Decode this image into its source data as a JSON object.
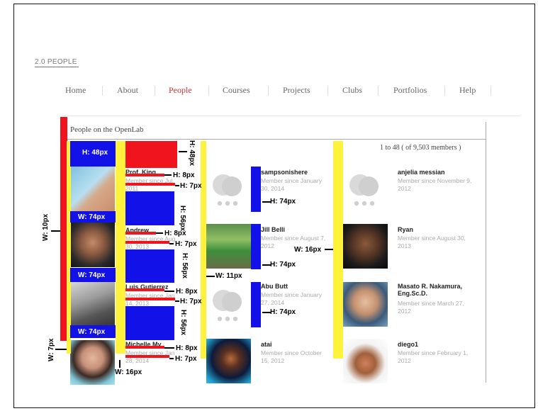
{
  "site_title": "2.0 PEOPLE",
  "nav": [
    "Home",
    "About",
    "People",
    "Courses",
    "Projects",
    "Clubs",
    "Portfolios",
    "Help"
  ],
  "nav_active_index": 2,
  "panel_title": "People on the OpenLab",
  "count_text": "1 to 48 ( of 9,503 members )",
  "colors": {
    "accent_link": "#c33",
    "overlay_red": "#f0141e",
    "overlay_yellow": "#fff23c",
    "overlay_blue": "#1111e8"
  },
  "annotations": {
    "h48": "H: 48px",
    "h8": "H: 8px",
    "h7": "H: 7px",
    "h56": "H: 56px",
    "w74": "W: 74px",
    "h74": "H: 74px",
    "w10": "W: 10px",
    "w7": "W: 7px",
    "w11": "W: 11px",
    "w16": "W: 16px"
  },
  "members": {
    "col1": [
      {
        "name": "Prof. King",
        "since": "Member since Jul 2011"
      },
      {
        "name": "Andrew",
        "since": "Member since Aug 30, 2013"
      },
      {
        "name": "Luis Gutierrez",
        "since": "Member since Jan 14, 2013"
      },
      {
        "name": "Michelle My",
        "since": "Member since Jan 28, 2014"
      }
    ],
    "col2": [
      {
        "name": "sampsonishere",
        "since": "Member since January 30, 2014"
      },
      {
        "name": "Jill Belli",
        "since": "Member since August 7, 2012"
      },
      {
        "name": "Abu Butt",
        "since": "Member since January 27, 2014"
      },
      {
        "name": "atai",
        "since": "Member since October 15, 2012"
      }
    ],
    "col3": [
      {
        "name": "anjelia messian",
        "since": "Member since November 9, 2012"
      },
      {
        "name": "Ryan",
        "since": "Member since August 30, 2013"
      },
      {
        "name": "Masato R. Nakamura, Eng.Sc.D.",
        "since": "Member since March 27, 2012"
      },
      {
        "name": "diego1",
        "since": "Member since February 1, 2012"
      }
    ]
  }
}
